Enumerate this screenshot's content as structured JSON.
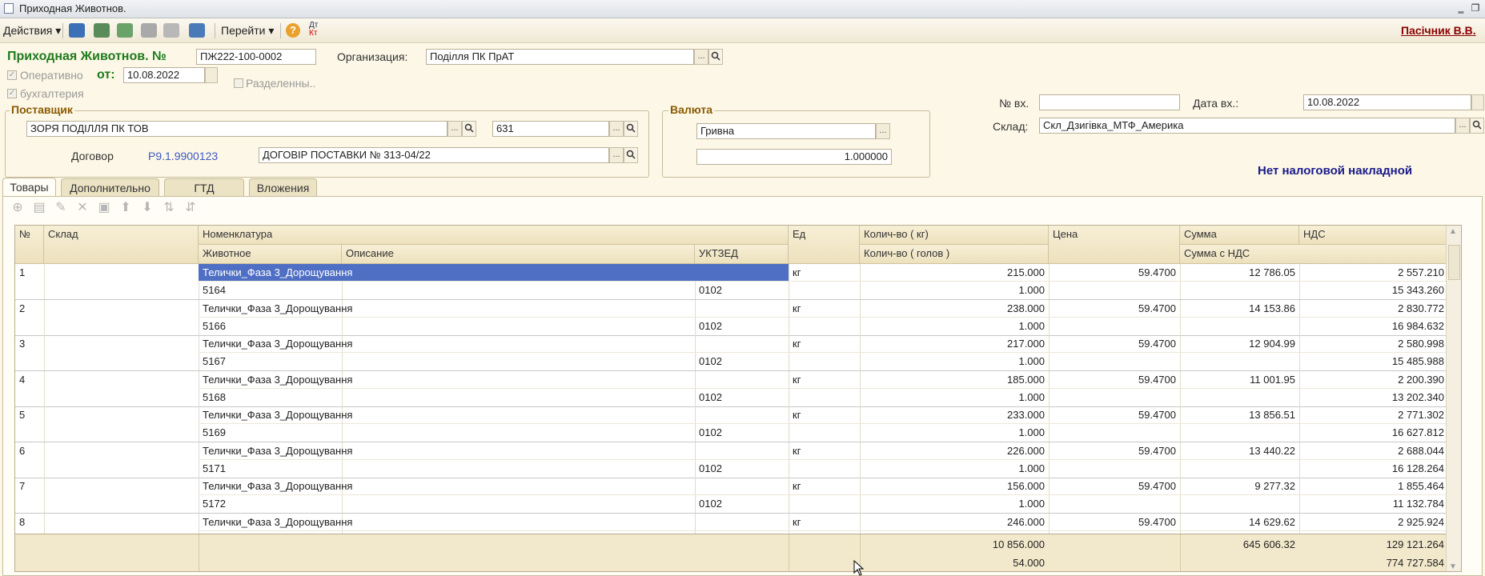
{
  "window": {
    "title": "Приходная Животнов."
  },
  "toolbar": {
    "actions": "Действия",
    "goto": "Перейти",
    "user": "Пасічник В.В."
  },
  "doc": {
    "title": "Приходная Животнов. №",
    "number": "ПЖ222-100-0002",
    "date_label": "от:",
    "date": "10.08.2022",
    "org_label": "Организация:",
    "org": "Поділля ПК ПрАТ",
    "oper": "Оперативно",
    "buh": "бухгалтерия",
    "split": "Разделенны..",
    "in_no_label": "№ вх.",
    "in_no": "",
    "in_date_label": "Дата вх.:",
    "in_date": "10.08.2022",
    "stock_label": "Склад:",
    "stock": "Скл_Дзигівка_МТФ_Америка",
    "tax_note": "Нет налоговой накладной"
  },
  "supplier": {
    "group": "Поставщик",
    "name": "ЗОРЯ ПОДІЛЛЯ ПК ТОВ",
    "code": "631",
    "contract_label": "Договор",
    "contract_code": "Р9.1.9900123",
    "contract": "ДОГОВІР ПОСТАВКИ № 313-04/22"
  },
  "currency": {
    "group": "Валюта",
    "name": "Гривна",
    "rate": "1.000000"
  },
  "tabs": [
    "Товары",
    "Дополнительно",
    "ГТД",
    "Вложения"
  ],
  "columns": {
    "no": "№",
    "stock": "Склад",
    "nom": "Номенклатура",
    "animal": "Животное",
    "descr": "Описание",
    "code": "УКТЗЕД",
    "unit": "Ед",
    "qty": "Колич-во ( кг)",
    "heads": "Колич-во ( голов )",
    "price": "Цена",
    "sum": "Сумма",
    "vat": "НДС",
    "total": "Сумма с НДС"
  },
  "rows": [
    {
      "n": "1",
      "nom": "Телички_Фаза 3_Дорощування",
      "animal": "5164",
      "code": "0102",
      "unit": "кг",
      "qty": "215.000",
      "heads": "1.000",
      "price": "59.4700",
      "sum": "12 786.05",
      "vat": "2 557.210",
      "total": "15 343.260"
    },
    {
      "n": "2",
      "nom": "Телички_Фаза 3_Дорощування",
      "animal": "5166",
      "code": "0102",
      "unit": "кг",
      "qty": "238.000",
      "heads": "1.000",
      "price": "59.4700",
      "sum": "14 153.86",
      "vat": "2 830.772",
      "total": "16 984.632"
    },
    {
      "n": "3",
      "nom": "Телички_Фаза 3_Дорощування",
      "animal": "5167",
      "code": "0102",
      "unit": "кг",
      "qty": "217.000",
      "heads": "1.000",
      "price": "59.4700",
      "sum": "12 904.99",
      "vat": "2 580.998",
      "total": "15 485.988"
    },
    {
      "n": "4",
      "nom": "Телички_Фаза 3_Дорощування",
      "animal": "5168",
      "code": "0102",
      "unit": "кг",
      "qty": "185.000",
      "heads": "1.000",
      "price": "59.4700",
      "sum": "11 001.95",
      "vat": "2 200.390",
      "total": "13 202.340"
    },
    {
      "n": "5",
      "nom": "Телички_Фаза 3_Дорощування",
      "animal": "5169",
      "code": "0102",
      "unit": "кг",
      "qty": "233.000",
      "heads": "1.000",
      "price": "59.4700",
      "sum": "13 856.51",
      "vat": "2 771.302",
      "total": "16 627.812"
    },
    {
      "n": "6",
      "nom": "Телички_Фаза 3_Дорощування",
      "animal": "5171",
      "code": "0102",
      "unit": "кг",
      "qty": "226.000",
      "heads": "1.000",
      "price": "59.4700",
      "sum": "13 440.22",
      "vat": "2 688.044",
      "total": "16 128.264"
    },
    {
      "n": "7",
      "nom": "Телички_Фаза 3_Дорощування",
      "animal": "5172",
      "code": "0102",
      "unit": "кг",
      "qty": "156.000",
      "heads": "1.000",
      "price": "59.4700",
      "sum": "9 277.32",
      "vat": "1 855.464",
      "total": "11 132.784"
    },
    {
      "n": "8",
      "nom": "Телички_Фаза 3_Дорощування",
      "animal": "",
      "code": "",
      "unit": "кг",
      "qty": "246.000",
      "heads": "",
      "price": "59.4700",
      "sum": "14 629.62",
      "vat": "2 925.924",
      "total": ""
    }
  ],
  "totals": {
    "qty": "10 856.000",
    "heads": "54.000",
    "sum": "645 606.32",
    "vat": "129 121.264",
    "total": "774 727.584"
  }
}
